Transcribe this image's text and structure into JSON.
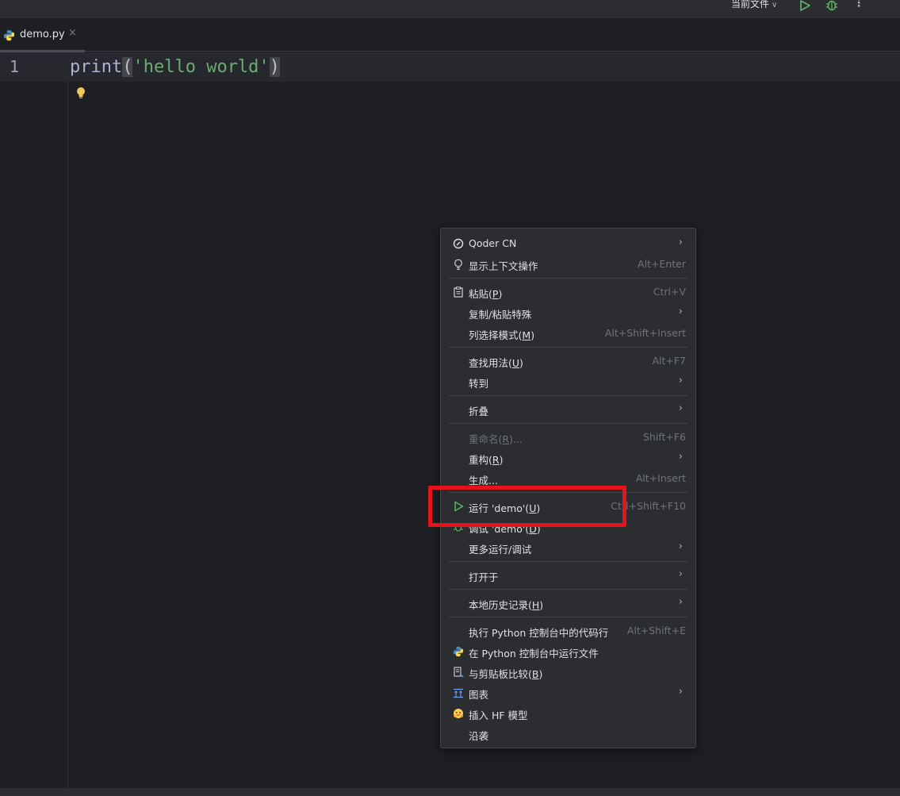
{
  "toolbar": {
    "run_config": "当前文件"
  },
  "tabs": [
    {
      "label": "demo.py"
    }
  ],
  "editor": {
    "line_number": "1",
    "code": {
      "fn": "print",
      "open_paren": "(",
      "string": "'hello world'",
      "close_paren": ")"
    }
  },
  "menu": {
    "items": [
      {
        "label": "Qoder CN",
        "mnemonic_pre": "",
        "mnemonic": "",
        "mnemonic_post": "",
        "shortcut": "",
        "submenu": true
      },
      {
        "label": "显示上下文操作",
        "shortcut": "Alt+Enter"
      },
      {
        "label_pre": "粘贴(",
        "mnemonic": "P",
        "label_post": ")",
        "shortcut": "Ctrl+V"
      },
      {
        "label": "复制/粘贴特殊",
        "submenu": true
      },
      {
        "label_pre": "列选择模式(",
        "mnemonic": "M",
        "label_post": ")",
        "shortcut": "Alt+Shift+Insert"
      },
      {
        "label_pre": "查找用法(",
        "mnemonic": "U",
        "label_post": ")",
        "shortcut": "Alt+F7"
      },
      {
        "label": "转到",
        "submenu": true
      },
      {
        "label": "折叠",
        "submenu": true
      },
      {
        "label_pre": "重命名(",
        "mnemonic": "R",
        "label_post": ")...",
        "shortcut": "Shift+F6",
        "disabled": true
      },
      {
        "label_pre": "重构(",
        "mnemonic": "R",
        "label_post": ")",
        "submenu": true
      },
      {
        "label": "生成...",
        "shortcut": "Alt+Insert"
      },
      {
        "label_pre": "运行 'demo'(",
        "mnemonic": "U",
        "label_post": ")",
        "shortcut": "Ctrl+Shift+F10"
      },
      {
        "label_pre": "调试 'demo'(",
        "mnemonic": "D",
        "label_post": ")"
      },
      {
        "label": "更多运行/调试",
        "submenu": true
      },
      {
        "label": "打开于",
        "submenu": true
      },
      {
        "label_pre": "本地历史记录(",
        "mnemonic": "H",
        "label_post": ")",
        "submenu": true
      },
      {
        "label": "执行 Python 控制台中的代码行",
        "shortcut": "Alt+Shift+E"
      },
      {
        "label": "在 Python 控制台中运行文件"
      },
      {
        "label_pre": "与剪贴板比较(",
        "mnemonic": "B",
        "label_post": ")"
      },
      {
        "label": "图表",
        "submenu": true
      },
      {
        "label": "插入 HF 模型"
      },
      {
        "label": "沿袭"
      }
    ]
  },
  "colors": {
    "accent_run": "#5fb865",
    "annotation": "#e6131d",
    "bulb": "#f2c55c"
  }
}
